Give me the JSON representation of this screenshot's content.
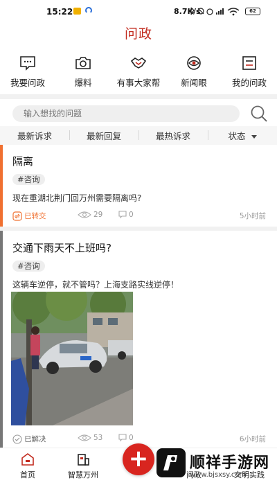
{
  "status_bar": {
    "time": "15:22",
    "net_speed": "8.7K/s",
    "battery": "62"
  },
  "header": {
    "title": "问政"
  },
  "functions": [
    {
      "label": "我要问政",
      "icon": "chat-bubble-icon"
    },
    {
      "label": "爆料",
      "icon": "camera-icon"
    },
    {
      "label": "有事大家帮",
      "icon": "handshake-icon"
    },
    {
      "label": "新闻眼",
      "icon": "eye-icon"
    },
    {
      "label": "我的问政",
      "icon": "document-icon"
    }
  ],
  "search": {
    "placeholder": "输入想找的问题"
  },
  "filters": [
    {
      "label": "最新诉求"
    },
    {
      "label": "最新回复"
    },
    {
      "label": "最热诉求"
    },
    {
      "label": "状态"
    }
  ],
  "posts": [
    {
      "title": "隔离",
      "tag": "#咨询",
      "body": "现在重湖北荆门回万州需要隔离吗?",
      "state": "已转交",
      "views": "29",
      "comments": "0",
      "time": "5小时前",
      "accent": "#f07030"
    },
    {
      "title": "交通下雨天不上班吗?",
      "tag": "#咨询",
      "body": "这辆车逆停，就不管吗？上海支路实线逆停！",
      "state": "已解决",
      "views": "53",
      "comments": "0",
      "time": "6小时前",
      "accent": "#777777"
    }
  ],
  "bottom_nav": [
    {
      "label": "首页",
      "icon": "home-icon"
    },
    {
      "label": "智慧万州",
      "icon": "building-icon"
    },
    {
      "label": "问政",
      "icon": "question-icon"
    },
    {
      "label": "文明实践",
      "icon": "star-icon"
    }
  ],
  "watermark": {
    "name": "顺祥手游网",
    "url": "www.bjsxsy.com"
  },
  "colors": {
    "brand_red": "#c22a1e",
    "fab_red": "#d8251f",
    "forwarded_orange": "#f07030"
  }
}
